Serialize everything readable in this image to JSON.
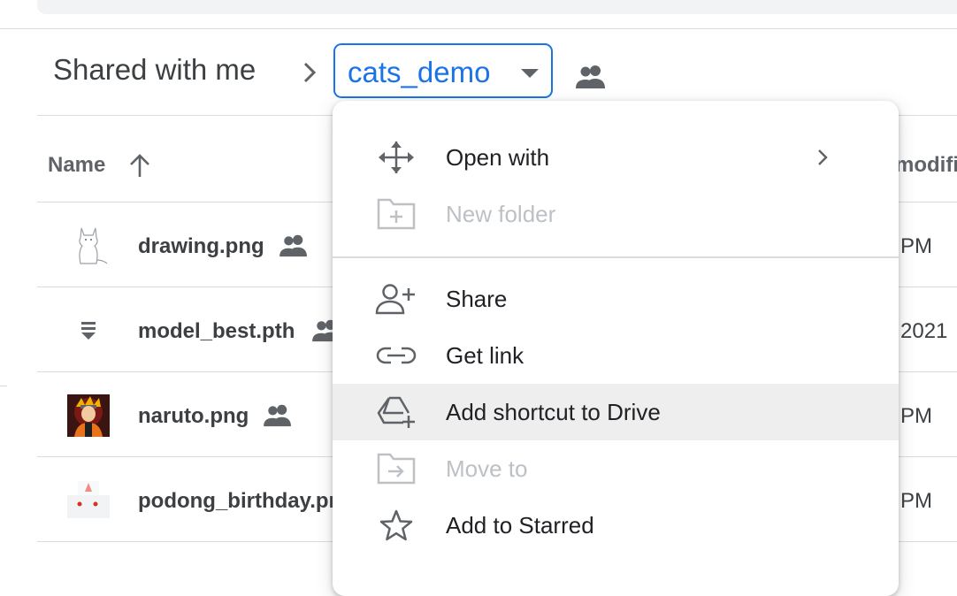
{
  "breadcrumb": {
    "root_label": "Shared with me",
    "current_folder": "cats_demo"
  },
  "table": {
    "columns": {
      "name": "Name",
      "modified": "modifi"
    },
    "rows": [
      {
        "name": "drawing.png",
        "modified": "PM",
        "shared": true
      },
      {
        "name": "model_best.pth",
        "modified": "2021",
        "shared": true
      },
      {
        "name": "naruto.png",
        "modified": "PM",
        "shared": true
      },
      {
        "name": "podong_birthday.pr",
        "modified": "PM",
        "shared": false
      }
    ]
  },
  "context_menu": {
    "items": [
      {
        "label": "Open with",
        "icon": "open-with-icon",
        "enabled": true,
        "has_submenu": true
      },
      {
        "label": "New folder",
        "icon": "new-folder-icon",
        "enabled": false
      },
      {
        "label": "Share",
        "icon": "add-person-icon",
        "enabled": true
      },
      {
        "label": "Get link",
        "icon": "link-icon",
        "enabled": true
      },
      {
        "label": "Add shortcut to Drive",
        "icon": "add-shortcut-icon",
        "enabled": true,
        "hovered": true
      },
      {
        "label": "Move to",
        "icon": "move-to-icon",
        "enabled": false
      },
      {
        "label": "Add to Starred",
        "icon": "star-icon",
        "enabled": true
      }
    ]
  },
  "colors": {
    "accent": "#1a73e8",
    "text": "#3c4043",
    "muted": "#5f6368",
    "disabled": "#bdc1c6",
    "hover": "#eeeeee"
  }
}
